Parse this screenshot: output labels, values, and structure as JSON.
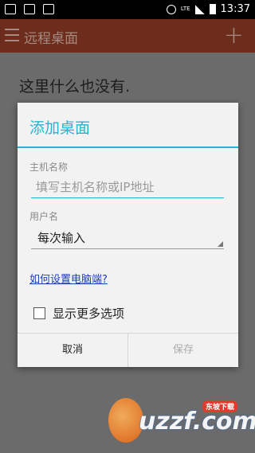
{
  "status_bar": {
    "time": "13:37",
    "network": "LTE"
  },
  "app_bar": {
    "title": "远程桌面",
    "menu_icon": "menu-icon",
    "add_icon": "plus-icon"
  },
  "main": {
    "empty_text": "这里什么也没有."
  },
  "dialog": {
    "title": "添加桌面",
    "host_label": "主机名称",
    "host_placeholder": "填写主机名称或IP地址",
    "host_value": "",
    "user_label": "用户名",
    "user_selected": "每次输入",
    "help_link": "如何设置电脑端?",
    "more_options_label": "显示更多选项",
    "more_options_checked": false,
    "cancel_label": "取消",
    "save_label": "保存"
  },
  "watermark": {
    "text": "uzzf.com",
    "badge": "东坡下载"
  },
  "colors": {
    "accent": "#2ab3d1",
    "link": "#1a3eb8",
    "app_bar": "#6d2c1c"
  }
}
